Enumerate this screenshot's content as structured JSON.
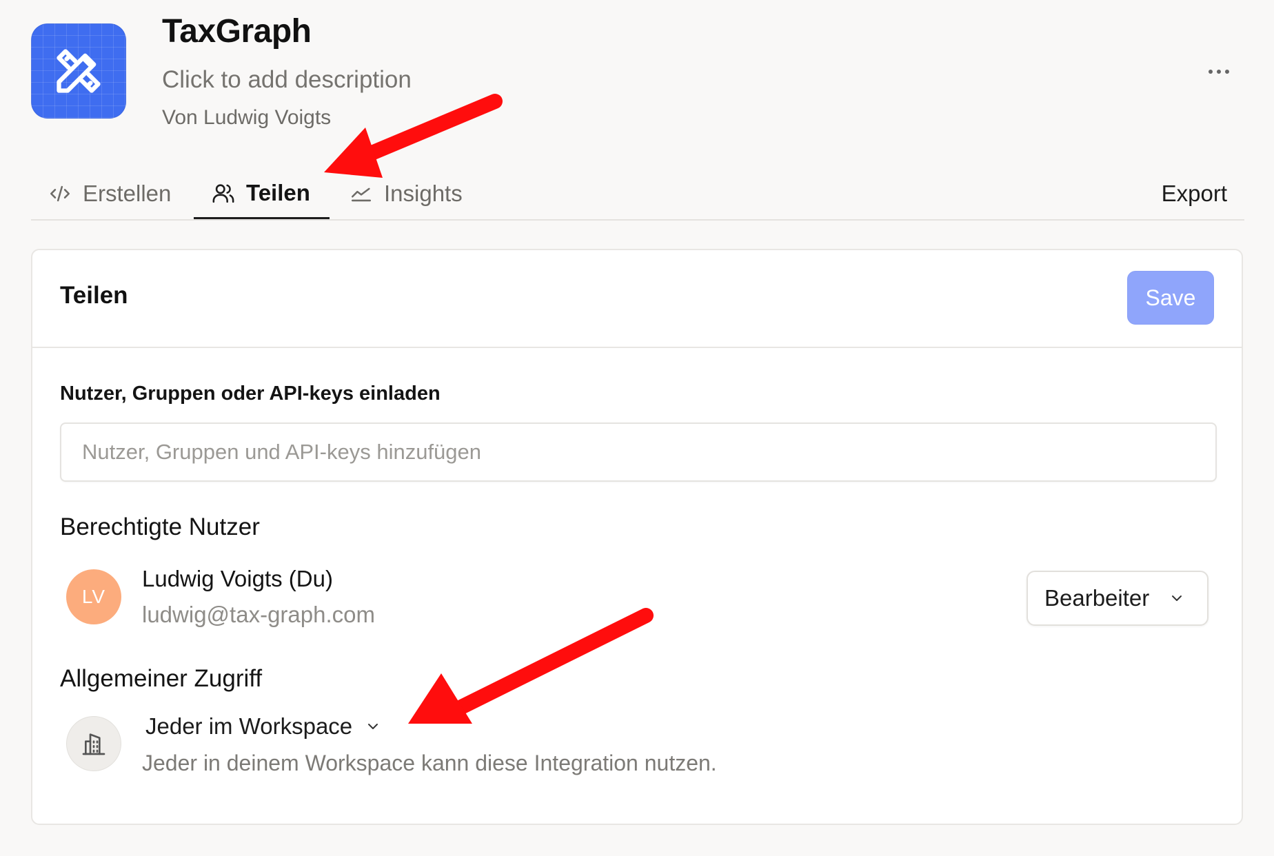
{
  "header": {
    "app_title": "TaxGraph",
    "description_placeholder": "Click to add description",
    "author": "Von Ludwig Voigts",
    "icon": "design-tools-icon",
    "icon_color": "#3f6df0"
  },
  "tabs": [
    {
      "label": "Erstellen",
      "icon": "code-icon",
      "active": false
    },
    {
      "label": "Teilen",
      "icon": "users-icon",
      "active": true
    },
    {
      "label": "Insights",
      "icon": "chart-line-icon",
      "active": false
    }
  ],
  "export_label": "Export",
  "more_icon": "ellipsis-icon",
  "share_panel": {
    "title": "Teilen",
    "save_label": "Save",
    "save_color": "#8fa5fb",
    "invite": {
      "label": "Nutzer, Gruppen oder API-keys einladen",
      "placeholder": "Nutzer, Gruppen und API-keys hinzufügen",
      "value": ""
    },
    "authorized_users": {
      "heading": "Berechtigte Nutzer",
      "users": [
        {
          "initials": "LV",
          "avatar_color": "#fcac7d",
          "name": "Ludwig Voigts (Du)",
          "email": "ludwig@tax-graph.com",
          "role": "Bearbeiter"
        }
      ]
    },
    "general_access": {
      "heading": "Allgemeiner Zugriff",
      "icon": "building-icon",
      "selected": "Jeder im Workspace",
      "description": "Jeder in deinem Workspace kann diese Integration nutzen."
    }
  },
  "annotation_color": "#ff0d0d"
}
